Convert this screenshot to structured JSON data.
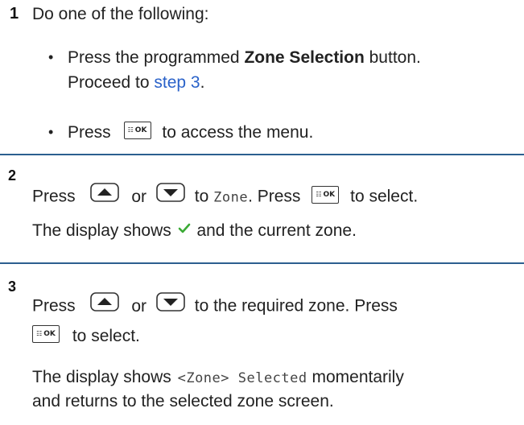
{
  "step1": {
    "number": "1",
    "intro": "Do one of the following:",
    "option_a": {
      "bullet": "•",
      "pre": "Press the programmed ",
      "bold": "Zone Selection",
      "post": " button.",
      "line2": "Proceed to ",
      "link": "step 3",
      "line2_end": "."
    },
    "option_b": {
      "bullet": "•",
      "pre": "Press",
      "post": "to access the menu."
    }
  },
  "step2": {
    "number": "2",
    "press": "Press",
    "or": "or",
    "to": "to",
    "menu_item": "Zone",
    "press_again": ". Press",
    "select": "to select.",
    "display_pre": "The display shows",
    "display_post": "and the current zone."
  },
  "step3": {
    "number": "3",
    "press": "Press",
    "or": "or",
    "to_zone": "to the required zone. Press",
    "select": "to select.",
    "display_pre": "The display shows",
    "display_mono": "<Zone> Selected",
    "display_post": "momentarily",
    "line2": "and returns to the selected zone screen."
  },
  "icons": {
    "ok_label": "OK",
    "ok_grid": "☷",
    "up": "nav-up-icon",
    "down": "nav-down-icon",
    "check": "checkmark-icon",
    "check_color": "#3aaa35"
  },
  "colors": {
    "divider": "#2c5f8f",
    "link": "#2a62c9"
  }
}
